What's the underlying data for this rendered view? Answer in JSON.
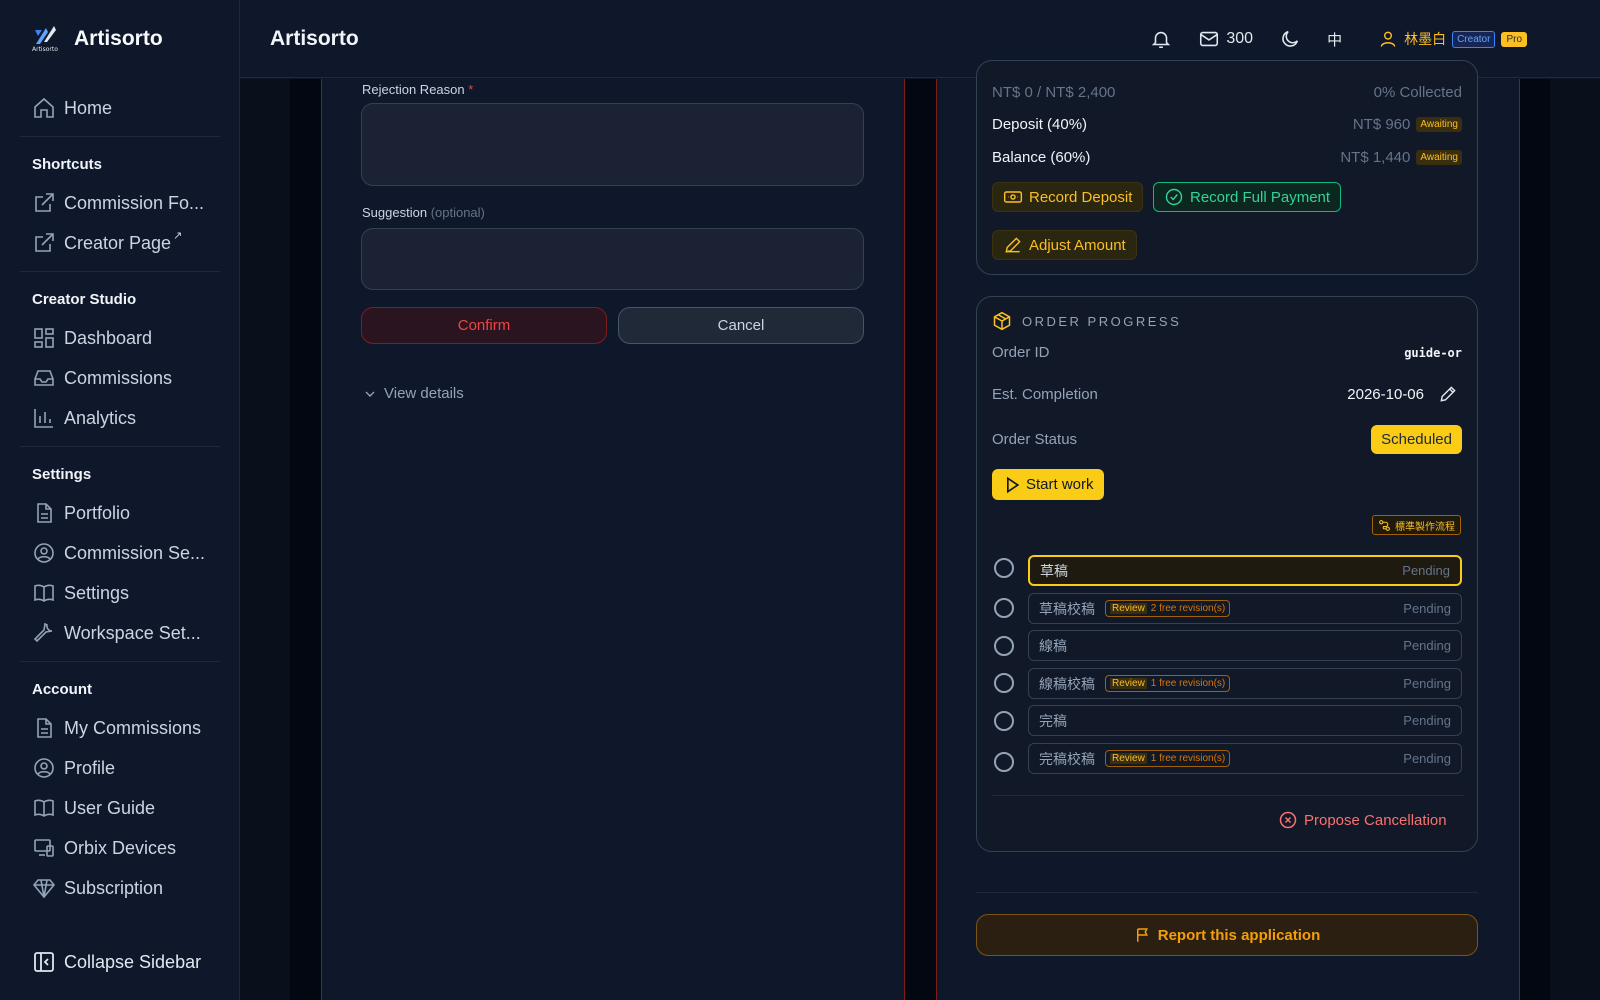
{
  "brand": {
    "name": "Artisorto",
    "logo_text": "Artisorto"
  },
  "sidebar": {
    "home": "Home",
    "shortcuts_title": "Shortcuts",
    "shortcuts": [
      "Commission Fo...",
      "Creator Page"
    ],
    "creator_studio_title": "Creator Studio",
    "creator_studio": [
      "Dashboard",
      "Commissions",
      "Analytics"
    ],
    "settings_title": "Settings",
    "settings": [
      "Portfolio",
      "Commission Se...",
      "Settings",
      "Workspace Set..."
    ],
    "account_title": "Account",
    "account": [
      "My Commissions",
      "Profile",
      "User Guide",
      "Orbix Devices",
      "Subscription"
    ],
    "collapse": "Collapse Sidebar"
  },
  "header": {
    "title": "Artisorto",
    "mail_count": "300",
    "lang": "中",
    "user_name": "林墨白",
    "role_badge": "Creator",
    "plan_badge": "Pro"
  },
  "rejection": {
    "reason_label": "Rejection Reason",
    "reason_required": "*",
    "reason_value": "",
    "suggestion_label": "Suggestion",
    "suggestion_optional": "(optional)",
    "suggestion_value": "",
    "confirm": "Confirm",
    "cancel": "Cancel",
    "view_details": "View details"
  },
  "payment": {
    "summary_left": "NT$ 0 / NT$ 2,400",
    "summary_right": "0% Collected",
    "deposit_label": "Deposit (40%)",
    "deposit_amount": "NT$ 960",
    "deposit_status": "Awaiting",
    "balance_label": "Balance (60%)",
    "balance_amount": "NT$ 1,440",
    "balance_status": "Awaiting",
    "record_deposit": "Record Deposit",
    "record_full": "Record Full Payment",
    "adjust": "Adjust Amount"
  },
  "progress": {
    "title": "ORDER PROGRESS",
    "order_id_label": "Order ID",
    "order_id": "guide-or",
    "est_label": "Est. Completion",
    "est_date": "2026-10-06",
    "status_label": "Order Status",
    "status": "Scheduled",
    "start_work": "Start work",
    "flow_tag": "標準製作流程",
    "steps": [
      {
        "name": "草稿",
        "status": "Pending",
        "review": "",
        "free": ""
      },
      {
        "name": "草稿校稿",
        "status": "Pending",
        "review": "Review",
        "free": "2 free revision(s)"
      },
      {
        "name": "線稿",
        "status": "Pending",
        "review": "",
        "free": ""
      },
      {
        "name": "線稿校稿",
        "status": "Pending",
        "review": "Review",
        "free": "1 free revision(s)"
      },
      {
        "name": "完稿",
        "status": "Pending",
        "review": "",
        "free": ""
      },
      {
        "name": "完稿校稿",
        "status": "Pending",
        "review": "Review",
        "free": "1 free revision(s)"
      }
    ],
    "propose_cancel": "Propose Cancellation"
  },
  "report": "Report this application",
  "colors": {
    "accent": "#facc15",
    "danger": "#ef4444",
    "success": "#34d399",
    "bg": "#0f172a"
  }
}
